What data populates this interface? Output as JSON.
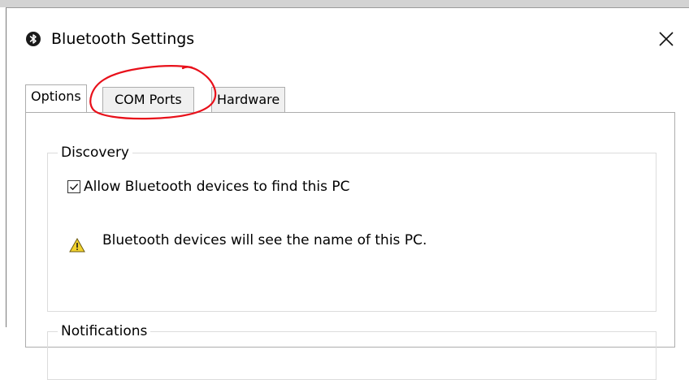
{
  "window": {
    "title": "Bluetooth Settings",
    "close_glyph": "✕",
    "icon": "bluetooth-icon"
  },
  "tabs": [
    {
      "label": "Options",
      "active": true
    },
    {
      "label": "COM Ports",
      "active": false
    },
    {
      "label": "Hardware",
      "active": false
    }
  ],
  "discovery": {
    "legend": "Discovery",
    "checkbox_label": "Allow Bluetooth devices to find this PC",
    "checked": true,
    "warning_text": "Bluetooth devices will see the name of this PC.",
    "warning_icon": "warning-icon"
  },
  "notifications": {
    "legend": "Notifications"
  },
  "colors": {
    "annotation": "#e8101a",
    "warning_fill": "#f2d22d",
    "border": "#adadad"
  }
}
